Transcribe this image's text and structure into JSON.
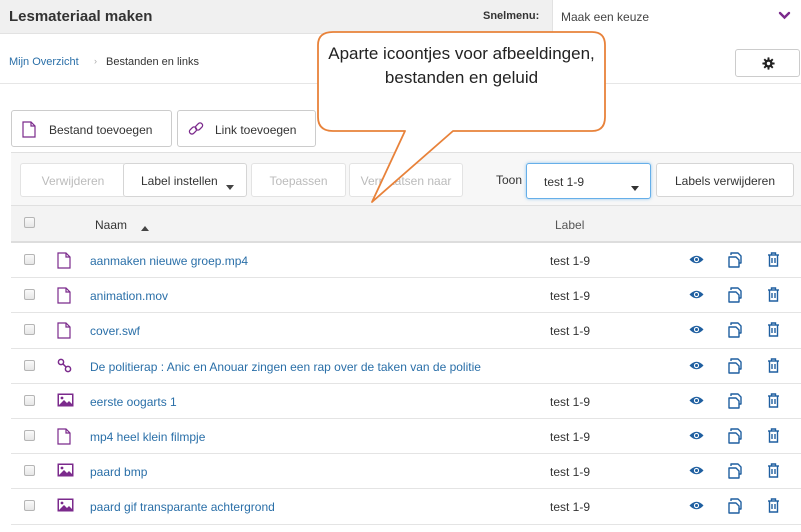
{
  "app": {
    "title": "Lesmateriaal maken"
  },
  "quickmenu": {
    "label": "Snelmenu:",
    "value": "Maak een keuze"
  },
  "breadcrumb": {
    "home": "Mijn Overzicht",
    "separator": "›",
    "current": "Bestanden en links"
  },
  "actions": {
    "add_file": "Bestand toevoegen",
    "add_link": "Link toevoegen"
  },
  "toolbar": {
    "delete": "Verwijderen",
    "set_label": "Label instellen",
    "apply": "Toepassen",
    "move_to": "Verplaatsen naar",
    "show_label": "Toon",
    "show_value": "test 1-9",
    "remove_labels": "Labels verwijderen"
  },
  "table": {
    "col_name": "Naam",
    "col_label": "Label",
    "rows": [
      {
        "type": "file",
        "name": "aanmaken nieuwe groep.mp4",
        "label": "test 1-9"
      },
      {
        "type": "file",
        "name": "animation.mov",
        "label": "test 1-9"
      },
      {
        "type": "file",
        "name": "cover.swf",
        "label": "test 1-9"
      },
      {
        "type": "link",
        "name": "De politierap : Anic en Anouar zingen een rap over de taken van de politie",
        "label": ""
      },
      {
        "type": "image",
        "name": "eerste oogarts 1",
        "label": "test 1-9"
      },
      {
        "type": "file",
        "name": "mp4 heel klein filmpje",
        "label": "test 1-9"
      },
      {
        "type": "image",
        "name": "paard bmp",
        "label": "test 1-9"
      },
      {
        "type": "image",
        "name": "paard gif transparante achtergrond",
        "label": "test 1-9"
      }
    ]
  },
  "callout": {
    "text": "Aparte icoontjes voor afbeeldingen, bestanden en geluid"
  },
  "colors": {
    "accent_purple": "#7b2a8c",
    "link_blue": "#2a6fa8",
    "action_blue": "#1f5fa0"
  },
  "icons": {
    "file": "file-icon",
    "link": "link-icon",
    "image": "image-icon",
    "view": "eye-icon",
    "copy": "copy-icon",
    "delete": "trash-icon",
    "settings": "gear-icon"
  }
}
